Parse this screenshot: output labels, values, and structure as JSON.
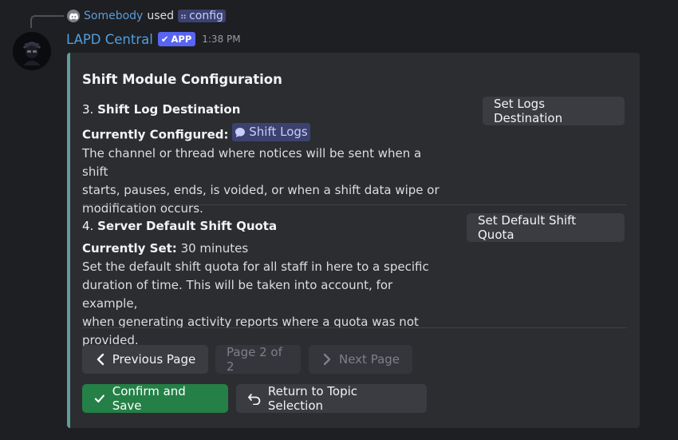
{
  "reply": {
    "user": "Somebody",
    "used_text": "used",
    "command": "config"
  },
  "message": {
    "username": "LAPD Central",
    "app_badge": "APP",
    "timestamp": "1:38 PM"
  },
  "embed": {
    "accent_color": "#5f9e9a",
    "title": "Shift Module Configuration",
    "section3": {
      "number": "3.",
      "title": "Shift Log Destination",
      "current_label": "Currently Configured:",
      "channel": "Shift Logs",
      "desc1": "The channel or thread where notices will be sent when a shift",
      "desc2": "starts, pauses, ends, is voided, or when a shift data wipe or",
      "desc3": "modification occurs.",
      "button": "Set Logs Destination"
    },
    "section4": {
      "number": "4.",
      "title": "Server Default Shift Quota",
      "current_label": "Currently Set:",
      "value": "30 minutes",
      "desc1": "Set the default shift quota for all staff in here to a specific",
      "desc2": "duration of time. This will be taken into account, for example,",
      "desc3": "when generating activity reports where a quota was not provided.",
      "button": "Set Default Shift Quota"
    }
  },
  "pagination": {
    "previous": "Previous Page",
    "page_indicator": "Page 2 of 2",
    "next": "Next Page"
  },
  "actions": {
    "confirm": "Confirm and Save",
    "return": "Return to Topic Selection"
  }
}
